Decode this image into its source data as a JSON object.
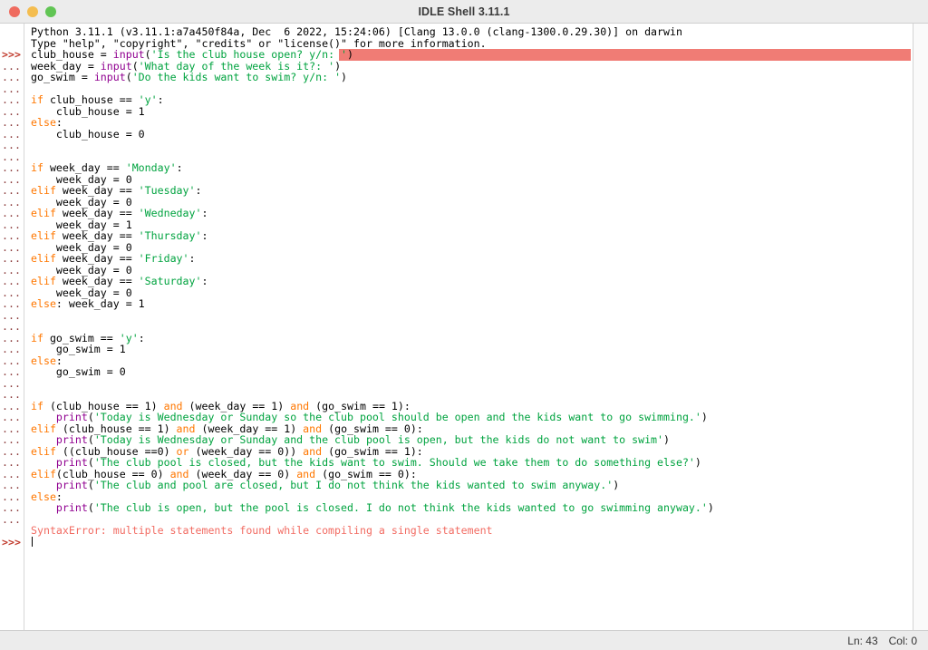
{
  "window": {
    "title": "IDLE Shell 3.11.1",
    "traffic_lights": [
      {
        "name": "close",
        "color": "#ef6b5f"
      },
      {
        "name": "minimize",
        "color": "#f4bd4f"
      },
      {
        "name": "maximize",
        "color": "#61c554"
      }
    ]
  },
  "colors": {
    "keyword": "#ff7700",
    "string": "#00a33f",
    "builtin": "#900090",
    "error": "#f26c63",
    "prompt": "#9a2f2f",
    "highlight": "#f07c75",
    "titlebar": "#ececec",
    "background": "#ffffff"
  },
  "statusbar": {
    "line_label": "Ln: 43",
    "col_label": "Col: 0"
  },
  "shell": {
    "banner": [
      "Python 3.11.1 (v3.11.1:a7a450f84a, Dec  6 2022, 15:24:06) [Clang 13.0.0 (clang-1300.0.29.30)] on darwin",
      "Type \"help\", \"copyright\", \"credits\" or \"license()\" for more information."
    ],
    "ps1": ">>>",
    "ps2": "...",
    "lines": [
      {
        "prompt": "ps1",
        "highlight": true,
        "tokens": [
          {
            "t": "club_house = ",
            "c": "def"
          },
          {
            "t": "input",
            "c": "bi"
          },
          {
            "t": "(",
            "c": "def"
          },
          {
            "t": "'Is the club house open? y/n: '",
            "c": "str"
          },
          {
            "t": ")",
            "c": "def"
          }
        ]
      },
      {
        "prompt": "ps2",
        "tokens": [
          {
            "t": "week_day = ",
            "c": "def"
          },
          {
            "t": "input",
            "c": "bi"
          },
          {
            "t": "(",
            "c": "def"
          },
          {
            "t": "'What day of the week is it?: '",
            "c": "str"
          },
          {
            "t": ")",
            "c": "def"
          }
        ]
      },
      {
        "prompt": "ps2",
        "tokens": [
          {
            "t": "go_swim = ",
            "c": "def"
          },
          {
            "t": "input",
            "c": "bi"
          },
          {
            "t": "(",
            "c": "def"
          },
          {
            "t": "'Do the kids want to swim? y/n: '",
            "c": "str"
          },
          {
            "t": ")",
            "c": "def"
          }
        ]
      },
      {
        "prompt": "ps2",
        "tokens": []
      },
      {
        "prompt": "ps2",
        "tokens": [
          {
            "t": "if",
            "c": "kw"
          },
          {
            "t": " club_house == ",
            "c": "def"
          },
          {
            "t": "'y'",
            "c": "str"
          },
          {
            "t": ":",
            "c": "def"
          }
        ]
      },
      {
        "prompt": "ps2",
        "tokens": [
          {
            "t": "    club_house = 1",
            "c": "def"
          }
        ]
      },
      {
        "prompt": "ps2",
        "tokens": [
          {
            "t": "else",
            "c": "kw"
          },
          {
            "t": ":",
            "c": "def"
          }
        ]
      },
      {
        "prompt": "ps2",
        "tokens": [
          {
            "t": "    club_house = 0",
            "c": "def"
          }
        ]
      },
      {
        "prompt": "ps2",
        "tokens": []
      },
      {
        "prompt": "ps2",
        "tokens": []
      },
      {
        "prompt": "ps2",
        "tokens": [
          {
            "t": "if",
            "c": "kw"
          },
          {
            "t": " week_day == ",
            "c": "def"
          },
          {
            "t": "'Monday'",
            "c": "str"
          },
          {
            "t": ":",
            "c": "def"
          }
        ]
      },
      {
        "prompt": "ps2",
        "tokens": [
          {
            "t": "    week_day = 0",
            "c": "def"
          }
        ]
      },
      {
        "prompt": "ps2",
        "tokens": [
          {
            "t": "elif",
            "c": "kw"
          },
          {
            "t": " week_day == ",
            "c": "def"
          },
          {
            "t": "'Tuesday'",
            "c": "str"
          },
          {
            "t": ":",
            "c": "def"
          }
        ]
      },
      {
        "prompt": "ps2",
        "tokens": [
          {
            "t": "    week_day = 0",
            "c": "def"
          }
        ]
      },
      {
        "prompt": "ps2",
        "tokens": [
          {
            "t": "elif",
            "c": "kw"
          },
          {
            "t": " week_day == ",
            "c": "def"
          },
          {
            "t": "'Wedneday'",
            "c": "str"
          },
          {
            "t": ":",
            "c": "def"
          }
        ]
      },
      {
        "prompt": "ps2",
        "tokens": [
          {
            "t": "    week_day = 1",
            "c": "def"
          }
        ]
      },
      {
        "prompt": "ps2",
        "tokens": [
          {
            "t": "elif",
            "c": "kw"
          },
          {
            "t": " week_day == ",
            "c": "def"
          },
          {
            "t": "'Thursday'",
            "c": "str"
          },
          {
            "t": ":",
            "c": "def"
          }
        ]
      },
      {
        "prompt": "ps2",
        "tokens": [
          {
            "t": "    week_day = 0",
            "c": "def"
          }
        ]
      },
      {
        "prompt": "ps2",
        "tokens": [
          {
            "t": "elif",
            "c": "kw"
          },
          {
            "t": " week_day == ",
            "c": "def"
          },
          {
            "t": "'Friday'",
            "c": "str"
          },
          {
            "t": ":",
            "c": "def"
          }
        ]
      },
      {
        "prompt": "ps2",
        "tokens": [
          {
            "t": "    week_day = 0",
            "c": "def"
          }
        ]
      },
      {
        "prompt": "ps2",
        "tokens": [
          {
            "t": "elif",
            "c": "kw"
          },
          {
            "t": " week_day == ",
            "c": "def"
          },
          {
            "t": "'Saturday'",
            "c": "str"
          },
          {
            "t": ":",
            "c": "def"
          }
        ]
      },
      {
        "prompt": "ps2",
        "tokens": [
          {
            "t": "    week_day = 0",
            "c": "def"
          }
        ]
      },
      {
        "prompt": "ps2",
        "tokens": [
          {
            "t": "else",
            "c": "kw"
          },
          {
            "t": ": week_day = 1",
            "c": "def"
          }
        ]
      },
      {
        "prompt": "ps2",
        "tokens": []
      },
      {
        "prompt": "ps2",
        "tokens": []
      },
      {
        "prompt": "ps2",
        "tokens": [
          {
            "t": "if",
            "c": "kw"
          },
          {
            "t": " go_swim == ",
            "c": "def"
          },
          {
            "t": "'y'",
            "c": "str"
          },
          {
            "t": ":",
            "c": "def"
          }
        ]
      },
      {
        "prompt": "ps2",
        "tokens": [
          {
            "t": "    go_swim = 1",
            "c": "def"
          }
        ]
      },
      {
        "prompt": "ps2",
        "tokens": [
          {
            "t": "else",
            "c": "kw"
          },
          {
            "t": ":",
            "c": "def"
          }
        ]
      },
      {
        "prompt": "ps2",
        "tokens": [
          {
            "t": "    go_swim = 0",
            "c": "def"
          }
        ]
      },
      {
        "prompt": "ps2",
        "tokens": []
      },
      {
        "prompt": "ps2",
        "tokens": []
      },
      {
        "prompt": "ps2",
        "tokens": [
          {
            "t": "if",
            "c": "kw"
          },
          {
            "t": " (club_house == 1) ",
            "c": "def"
          },
          {
            "t": "and",
            "c": "kw"
          },
          {
            "t": " (week_day == 1) ",
            "c": "def"
          },
          {
            "t": "and",
            "c": "kw"
          },
          {
            "t": " (go_swim == 1):",
            "c": "def"
          }
        ]
      },
      {
        "prompt": "ps2",
        "tokens": [
          {
            "t": "    ",
            "c": "def"
          },
          {
            "t": "print",
            "c": "bi"
          },
          {
            "t": "(",
            "c": "def"
          },
          {
            "t": "'Today is Wednesday or Sunday so the club pool should be open and the kids want to go swimming.'",
            "c": "str"
          },
          {
            "t": ")",
            "c": "def"
          }
        ]
      },
      {
        "prompt": "ps2",
        "tokens": [
          {
            "t": "elif",
            "c": "kw"
          },
          {
            "t": " (club_house == 1) ",
            "c": "def"
          },
          {
            "t": "and",
            "c": "kw"
          },
          {
            "t": " (week_day == 1) ",
            "c": "def"
          },
          {
            "t": "and",
            "c": "kw"
          },
          {
            "t": " (go_swim == 0):",
            "c": "def"
          }
        ]
      },
      {
        "prompt": "ps2",
        "tokens": [
          {
            "t": "    ",
            "c": "def"
          },
          {
            "t": "print",
            "c": "bi"
          },
          {
            "t": "(",
            "c": "def"
          },
          {
            "t": "'Today is Wednesday or Sunday and the club pool is open, but the kids do not want to swim'",
            "c": "str"
          },
          {
            "t": ")",
            "c": "def"
          }
        ]
      },
      {
        "prompt": "ps2",
        "tokens": [
          {
            "t": "elif",
            "c": "kw"
          },
          {
            "t": " ((club_house ==0) ",
            "c": "def"
          },
          {
            "t": "or",
            "c": "kw"
          },
          {
            "t": " (week_day == 0)) ",
            "c": "def"
          },
          {
            "t": "and",
            "c": "kw"
          },
          {
            "t": " (go_swim == 1):",
            "c": "def"
          }
        ]
      },
      {
        "prompt": "ps2",
        "tokens": [
          {
            "t": "    ",
            "c": "def"
          },
          {
            "t": "print",
            "c": "bi"
          },
          {
            "t": "(",
            "c": "def"
          },
          {
            "t": "'The club pool is closed, but the kids want to swim. Should we take them to do something else?'",
            "c": "str"
          },
          {
            "t": ")",
            "c": "def"
          }
        ]
      },
      {
        "prompt": "ps2",
        "tokens": [
          {
            "t": "elif",
            "c": "kw"
          },
          {
            "t": "(club_house == 0) ",
            "c": "def"
          },
          {
            "t": "and",
            "c": "kw"
          },
          {
            "t": " (week_day == 0) ",
            "c": "def"
          },
          {
            "t": "and",
            "c": "kw"
          },
          {
            "t": " (go_swim == 0):",
            "c": "def"
          }
        ]
      },
      {
        "prompt": "ps2",
        "tokens": [
          {
            "t": "    ",
            "c": "def"
          },
          {
            "t": "print",
            "c": "bi"
          },
          {
            "t": "(",
            "c": "def"
          },
          {
            "t": "'The club and pool are closed, but I do not think the kids wanted to swim anyway.'",
            "c": "str"
          },
          {
            "t": ")",
            "c": "def"
          }
        ]
      },
      {
        "prompt": "ps2",
        "tokens": [
          {
            "t": "else",
            "c": "kw"
          },
          {
            "t": ":",
            "c": "def"
          }
        ]
      },
      {
        "prompt": "ps2",
        "tokens": [
          {
            "t": "    ",
            "c": "def"
          },
          {
            "t": "print",
            "c": "bi"
          },
          {
            "t": "(",
            "c": "def"
          },
          {
            "t": "'The club is open, but the pool is closed. I do not think the kids wanted to go swimming anyway.'",
            "c": "str"
          },
          {
            "t": ")",
            "c": "def"
          }
        ]
      },
      {
        "prompt": "ps2",
        "tokens": []
      },
      {
        "prompt": "none",
        "tokens": [
          {
            "t": "SyntaxError: multiple statements found while compiling a single statement",
            "c": "err"
          }
        ]
      },
      {
        "prompt": "ps1",
        "caret": true,
        "tokens": []
      }
    ]
  }
}
